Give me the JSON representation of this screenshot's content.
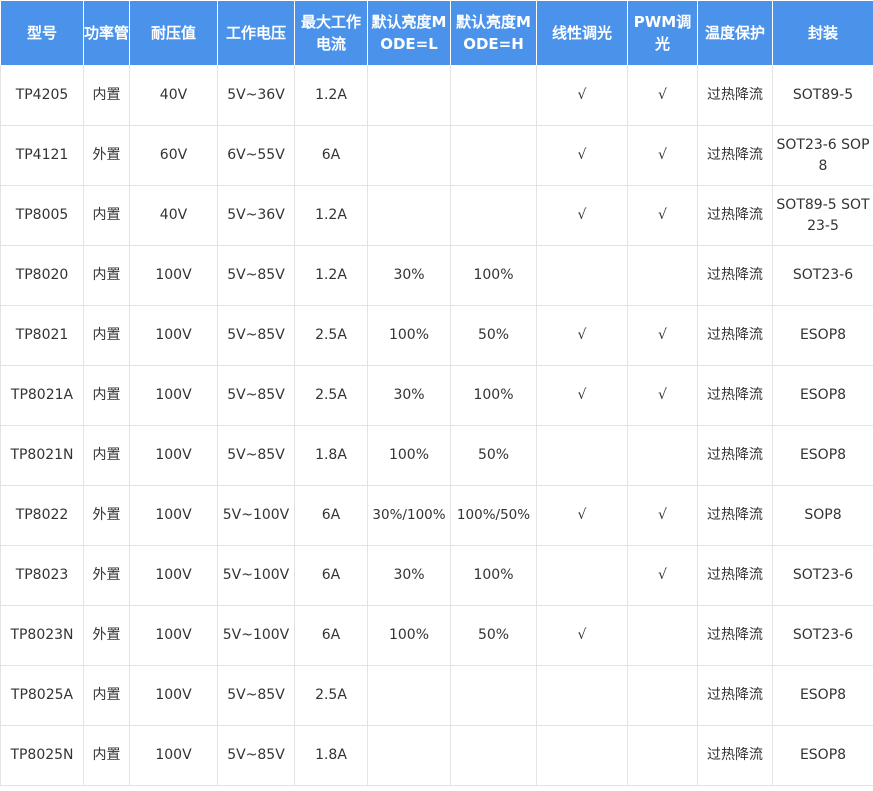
{
  "table": {
    "columns": [
      "型号",
      "功率管",
      "耐压值",
      "工作电压",
      "最大工作电流",
      "默认亮度MODE=L",
      "默认亮度MODE=H",
      "线性调光",
      "PWM调光",
      "温度保护",
      "封装"
    ],
    "rows": [
      [
        "TP4205",
        "内置",
        "40V",
        "5V~36V",
        "1.2A",
        "",
        "",
        "√",
        "√",
        "过热降流",
        "SOT89-5"
      ],
      [
        "TP4121",
        "外置",
        "60V",
        "6V~55V",
        "6A",
        "",
        "",
        "√",
        "√",
        "过热降流",
        "SOT23-6 SOP8"
      ],
      [
        "TP8005",
        "内置",
        "40V",
        "5V~36V",
        "1.2A",
        "",
        "",
        "√",
        "√",
        "过热降流",
        "SOT89-5 SOT23-5"
      ],
      [
        "TP8020",
        "内置",
        "100V",
        "5V~85V",
        "1.2A",
        "30%",
        "100%",
        "",
        "",
        "过热降流",
        "SOT23-6"
      ],
      [
        "TP8021",
        "内置",
        "100V",
        "5V~85V",
        "2.5A",
        "100%",
        "50%",
        "√",
        "√",
        "过热降流",
        "ESOP8"
      ],
      [
        "TP8021A",
        "内置",
        "100V",
        "5V~85V",
        "2.5A",
        "30%",
        "100%",
        "√",
        "√",
        "过热降流",
        "ESOP8"
      ],
      [
        "TP8021N",
        "内置",
        "100V",
        "5V~85V",
        "1.8A",
        "100%",
        "50%",
        "",
        "",
        "过热降流",
        "ESOP8"
      ],
      [
        "TP8022",
        "外置",
        "100V",
        "5V~100V",
        "6A",
        "30%/100%",
        "100%/50%",
        "√",
        "√",
        "过热降流",
        "SOP8"
      ],
      [
        "TP8023",
        "外置",
        "100V",
        "5V~100V",
        "6A",
        "30%",
        "100%",
        "",
        "√",
        "过热降流",
        "SOT23-6"
      ],
      [
        "TP8023N",
        "外置",
        "100V",
        "5V~100V",
        "6A",
        "100%",
        "50%",
        "√",
        "",
        "过热降流",
        "SOT23-6"
      ],
      [
        "TP8025A",
        "内置",
        "100V",
        "5V~85V",
        "2.5A",
        "",
        "",
        "",
        "",
        "过热降流",
        "ESOP8"
      ],
      [
        "TP8025N",
        "内置",
        "100V",
        "5V~85V",
        "1.8A",
        "",
        "",
        "",
        "",
        "过热降流",
        "ESOP8"
      ]
    ]
  }
}
